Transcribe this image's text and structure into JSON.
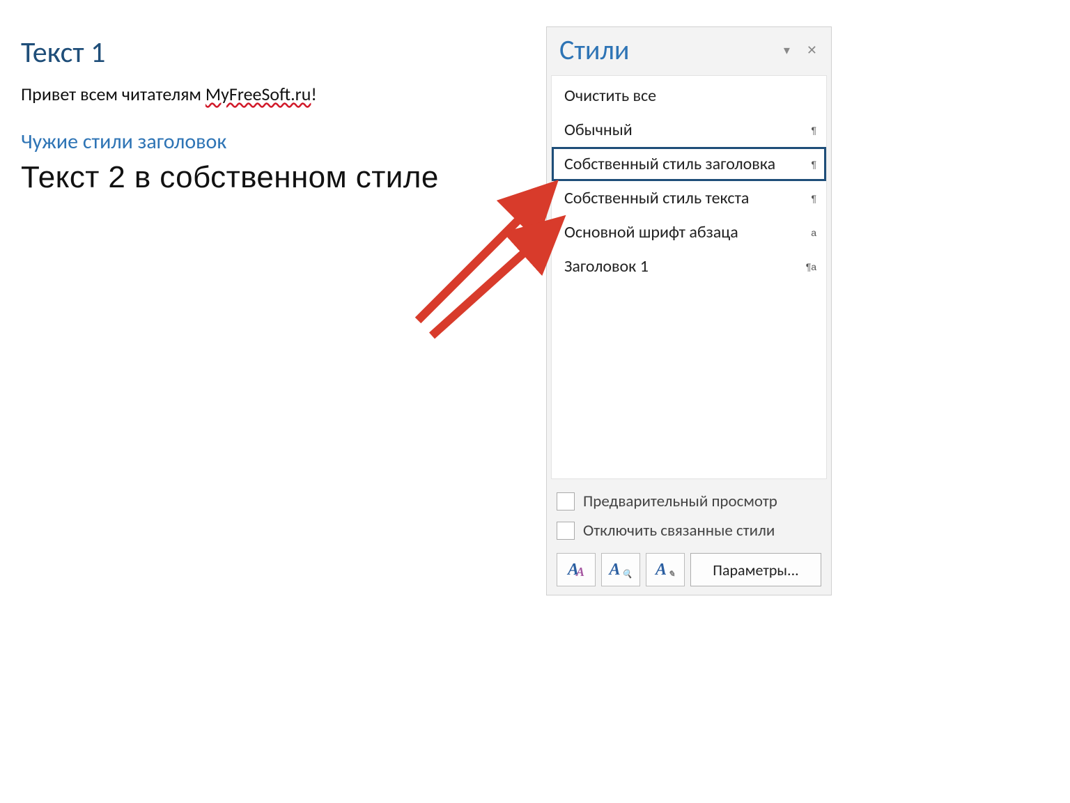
{
  "document": {
    "heading1": "Текст 1",
    "body_prefix": "Привет всем читателям",
    "body_spellerr": "MyFreeSoft.ru",
    "body_suffix": "!",
    "heading2": "Чужие стили заголовок",
    "custom_text": "Текст 2 в собственном стиле"
  },
  "panel": {
    "title": "Стили",
    "styles": [
      {
        "label": "Очистить все",
        "glyph": "",
        "selected": false
      },
      {
        "label": "Обычный",
        "glyph": "¶",
        "selected": false
      },
      {
        "label": "Собственный стиль заголовка",
        "glyph": "¶",
        "selected": true
      },
      {
        "label": "Собственный стиль текста",
        "glyph": "¶",
        "selected": false
      },
      {
        "label": "Основной шрифт абзаца",
        "glyph": "a",
        "selected": false
      },
      {
        "label": "Заголовок 1",
        "glyph": "¶a",
        "selected": false
      }
    ],
    "preview_label": "Предварительный просмотр",
    "disable_linked_label": "Отключить связанные стили",
    "options_button": "Параметры..."
  },
  "colors": {
    "heading_blue_dark": "#1F4E79",
    "heading_blue": "#2E74B5",
    "arrow_red": "#D83B2B"
  }
}
